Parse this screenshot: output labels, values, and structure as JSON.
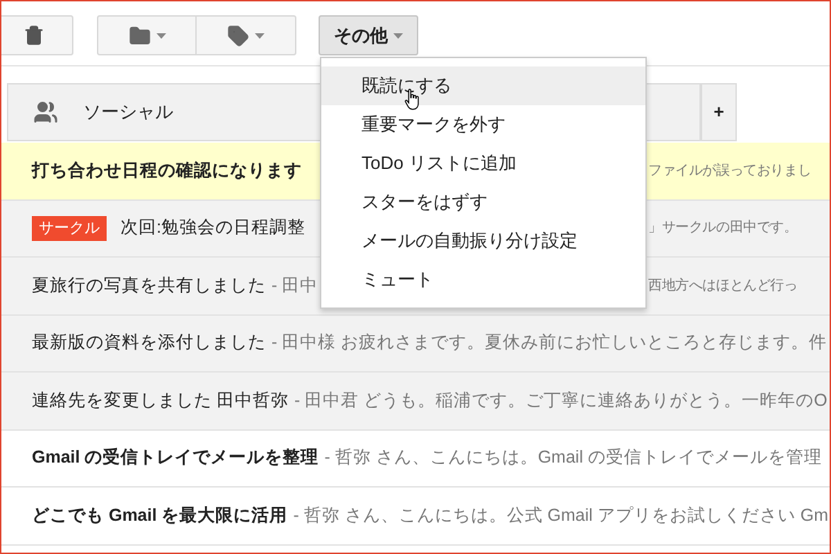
{
  "toolbar": {
    "more_button": {
      "label": "その他",
      "expanded": true
    }
  },
  "menu": {
    "items": [
      {
        "label": "既読にする",
        "selected": true
      },
      {
        "label": "重要マークを外す",
        "selected": false
      },
      {
        "label": "ToDo リストに追加",
        "selected": false
      },
      {
        "label": "スターをはずす",
        "selected": false
      },
      {
        "label": "メールの自動振り分け設定",
        "selected": false
      },
      {
        "label": "ミュート",
        "selected": false
      }
    ]
  },
  "tabs": [
    {
      "label": "ソーシャル"
    },
    {
      "label": "+"
    }
  ],
  "messages": [
    {
      "subject": "打ち合わせ日程の確認になります",
      "snippet_right": "ファイルが誤っておりまし",
      "unread": true,
      "selected": true
    },
    {
      "label": {
        "text": "サークル",
        "color": "#f04b2e"
      },
      "subject": "次回:勉強会の日程調整",
      "snippet_right": "」サークルの田中です。",
      "unread": false,
      "selected": false
    },
    {
      "subject": "夏旅行の写真を共有しました",
      "snippet": "- 田中",
      "snippet_right": "西地方へはほとんど行っ",
      "unread": false,
      "selected": false
    },
    {
      "subject": "最新版の資料を添付しました",
      "snippet": "- 田中様 お疲れさまです。夏休み前にお忙しいところと存じます。件",
      "unread": false,
      "selected": false
    },
    {
      "subject": "連絡先を変更しました 田中哲弥",
      "snippet": "- 田中君 どうも。稲浦です。ご丁寧に連絡ありがとう。一昨年のO",
      "unread": false,
      "selected": false
    },
    {
      "subject": "Gmail の受信トレイでメールを整理",
      "snippet": "- 哲弥 さん、こんにちは。Gmail の受信トレイでメールを管理",
      "unread": true,
      "selected": false
    },
    {
      "subject": "どこでも Gmail を最大限に活用",
      "snippet": "- 哲弥 さん、こんにちは。公式 Gmail アプリをお試しください Gm",
      "unread": true,
      "selected": false
    }
  ]
}
